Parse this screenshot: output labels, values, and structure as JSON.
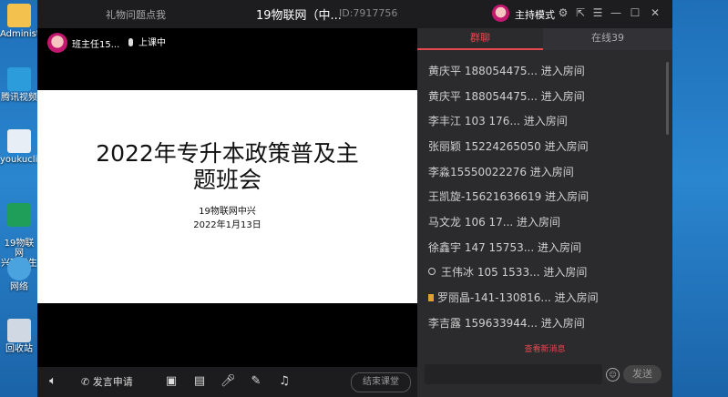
{
  "desktop": {
    "icons": [
      {
        "label": "Administ",
        "color": "#f2c14e"
      },
      {
        "label": "腾讯视频",
        "color": "#2d9cdb"
      },
      {
        "label": "youkuclie",
        "color": "#e8eef5"
      },
      {
        "label": "19物联网\n兴班学生信",
        "color": "#1e9e58"
      },
      {
        "label": "网络",
        "color": "#4aa3df"
      },
      {
        "label": "回收站",
        "color": "#cfd8e3"
      }
    ]
  },
  "titlebar": {
    "gift_label": "礼物问题点我",
    "room_title": "19物联网（中...",
    "room_id": "ID:7917756",
    "mode_label": "主持模式",
    "settings_icon": "gear-icon",
    "share_icon": "external-link-icon",
    "menu_icon": "menu-icon",
    "minimize_icon": "minimize-icon",
    "maximize_icon": "maximize-icon",
    "close_icon": "close-icon"
  },
  "stage": {
    "host_name": "班主任15...",
    "status": "上课中",
    "slide": {
      "title_line1": "2022年专升本政策普及主",
      "title_line2": "题班会",
      "subtitle": "19物联网中兴",
      "date": "2022年1月13日"
    }
  },
  "toolbar": {
    "apply_label": "发言申请",
    "end_label": "结束课堂"
  },
  "panel": {
    "tabs": [
      {
        "label": "群聊"
      },
      {
        "label": "在线39"
      }
    ],
    "messages": [
      {
        "text": "黄庆平  188054475... 进入房间"
      },
      {
        "text": "黄庆平  188054475... 进入房间"
      },
      {
        "text": "李丰江   103  176... 进入房间"
      },
      {
        "text": "张丽颖 15224265050 进入房间"
      },
      {
        "text": "李淼15550022276 进入房间"
      },
      {
        "text": "王凯旋-15621636619 进入房间"
      },
      {
        "text": "马文龙  106     17... 进入房间"
      },
      {
        "text": "徐鑫宇 147  15753... 进入房间"
      },
      {
        "text": "王伟冰 105 1533... 进入房间"
      },
      {
        "text": "罗丽晶-141-130816... 进入房间"
      },
      {
        "text": "李吉露   159633944... 进入房间"
      }
    ],
    "new_messages_label": "查看新消息",
    "send_label": "发送"
  },
  "colors": {
    "accent": "#e5484d",
    "panel_bg": "#2b2b2e",
    "window_bg": "#1c1c1e"
  }
}
